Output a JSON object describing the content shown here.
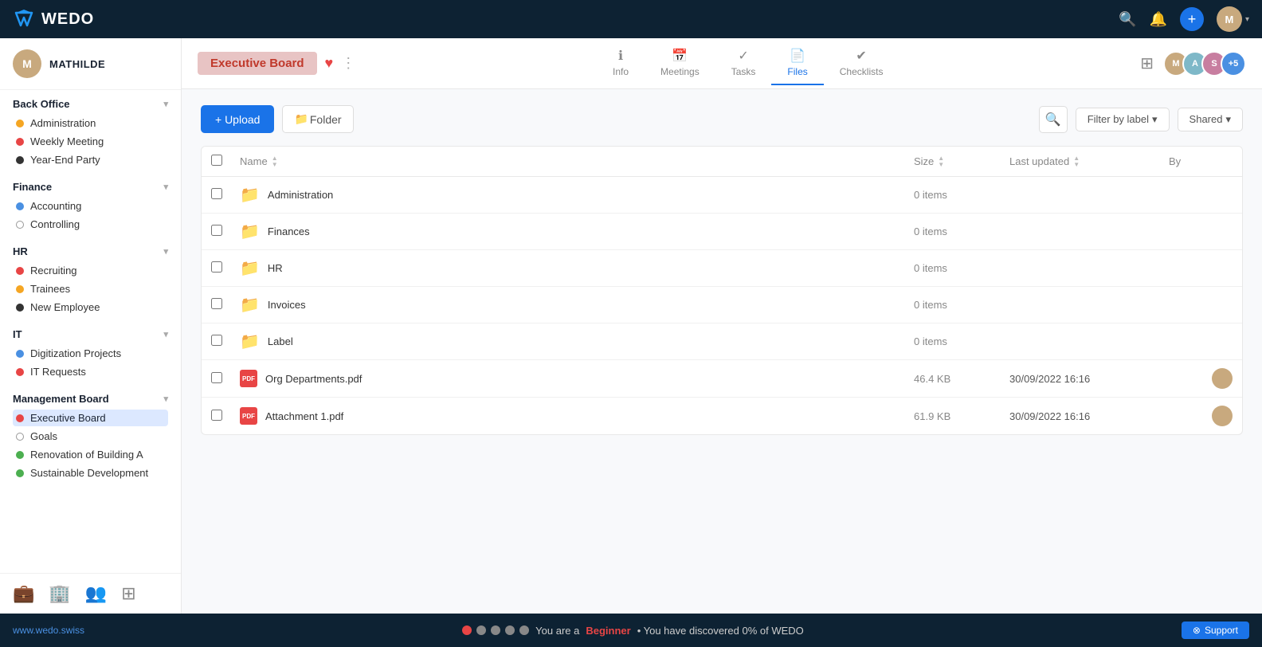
{
  "app": {
    "logo_text": "WEDO",
    "user": {
      "name": "MATHILDE",
      "initials": "M"
    }
  },
  "topbar": {
    "search_icon": "search",
    "bell_icon": "bell",
    "add_icon": "+",
    "user_chevron": "▾"
  },
  "sidebar": {
    "sections": [
      {
        "id": "back-office",
        "label": "Back Office",
        "items": [
          {
            "id": "administration",
            "label": "Administration",
            "dot": "yellow"
          },
          {
            "id": "weekly-meeting",
            "label": "Weekly Meeting",
            "dot": "red"
          },
          {
            "id": "year-end-party",
            "label": "Year-End Party",
            "dot": "dark"
          }
        ]
      },
      {
        "id": "finance",
        "label": "Finance",
        "items": [
          {
            "id": "accounting",
            "label": "Accounting",
            "dot": "blue"
          },
          {
            "id": "controlling",
            "label": "Controlling",
            "dot": "outline"
          }
        ]
      },
      {
        "id": "hr",
        "label": "HR",
        "items": [
          {
            "id": "recruiting",
            "label": "Recruiting",
            "dot": "red"
          },
          {
            "id": "trainees",
            "label": "Trainees",
            "dot": "yellow"
          },
          {
            "id": "new-employee",
            "label": "New Employee",
            "dot": "dark"
          }
        ]
      },
      {
        "id": "it",
        "label": "IT",
        "items": [
          {
            "id": "digitization-projects",
            "label": "Digitization Projects",
            "dot": "blue"
          },
          {
            "id": "it-requests",
            "label": "IT Requests",
            "dot": "red"
          }
        ]
      },
      {
        "id": "management-board",
        "label": "Management Board",
        "items": [
          {
            "id": "executive-board",
            "label": "Executive Board",
            "dot": "red",
            "active": true
          },
          {
            "id": "goals",
            "label": "Goals",
            "dot": "outline"
          },
          {
            "id": "renovation-of-building-a",
            "label": "Renovation of Building A",
            "dot": "green"
          },
          {
            "id": "sustainable-development",
            "label": "Sustainable Development",
            "dot": "green"
          }
        ]
      }
    ],
    "bottom_icons": [
      "briefcase",
      "building",
      "person-group",
      "grid"
    ]
  },
  "board": {
    "title": "Executive Board",
    "heart": "♥",
    "dots": "⋮"
  },
  "tabs": [
    {
      "id": "info",
      "label": "Info",
      "icon": "ℹ"
    },
    {
      "id": "meetings",
      "label": "Meetings",
      "icon": "📅"
    },
    {
      "id": "tasks",
      "label": "Tasks",
      "icon": "✓"
    },
    {
      "id": "files",
      "label": "Files",
      "icon": "📄",
      "active": true
    },
    {
      "id": "checklists",
      "label": "Checklists",
      "icon": "✔"
    }
  ],
  "members": [
    {
      "initials": "M",
      "color": "#c8a97e"
    },
    {
      "initials": "A",
      "color": "#7eb8c8"
    },
    {
      "initials": "S",
      "color": "#c87ea0"
    },
    {
      "more": "+5"
    }
  ],
  "files": {
    "upload_label": "+ Upload",
    "folder_label": "📁 Folder",
    "filter_label": "Filter by label",
    "shared_label": "Shared",
    "columns": {
      "name": "Name",
      "size": "Size",
      "last_updated": "Last updated",
      "by": "By"
    },
    "rows": [
      {
        "id": "administration-folder",
        "type": "folder",
        "name": "Administration",
        "size": "0 items",
        "date": "",
        "has_avatar": false
      },
      {
        "id": "finances-folder",
        "type": "folder",
        "name": "Finances",
        "size": "0 items",
        "date": "",
        "has_avatar": false
      },
      {
        "id": "hr-folder",
        "type": "folder",
        "name": "HR",
        "size": "0 items",
        "date": "",
        "has_avatar": false
      },
      {
        "id": "invoices-folder",
        "type": "folder",
        "name": "Invoices",
        "size": "0 items",
        "date": "",
        "has_avatar": false
      },
      {
        "id": "label-folder",
        "type": "folder",
        "name": "Label",
        "size": "0 items",
        "date": "",
        "has_avatar": false
      },
      {
        "id": "org-departments",
        "type": "pdf",
        "name": "Org Departments.pdf",
        "size": "46.4 KB",
        "date": "30/09/2022 16:16",
        "has_avatar": true
      },
      {
        "id": "attachment-1",
        "type": "pdf",
        "name": "Attachment 1.pdf",
        "size": "61.9 KB",
        "date": "30/09/2022 16:16",
        "has_avatar": true
      }
    ]
  },
  "bottombar": {
    "website": "www.wedo.swiss",
    "progress_label": "You are a",
    "beginner": "Beginner",
    "progress_suffix": "• You have discovered 0% of WEDO",
    "support": "⊗ Support"
  }
}
